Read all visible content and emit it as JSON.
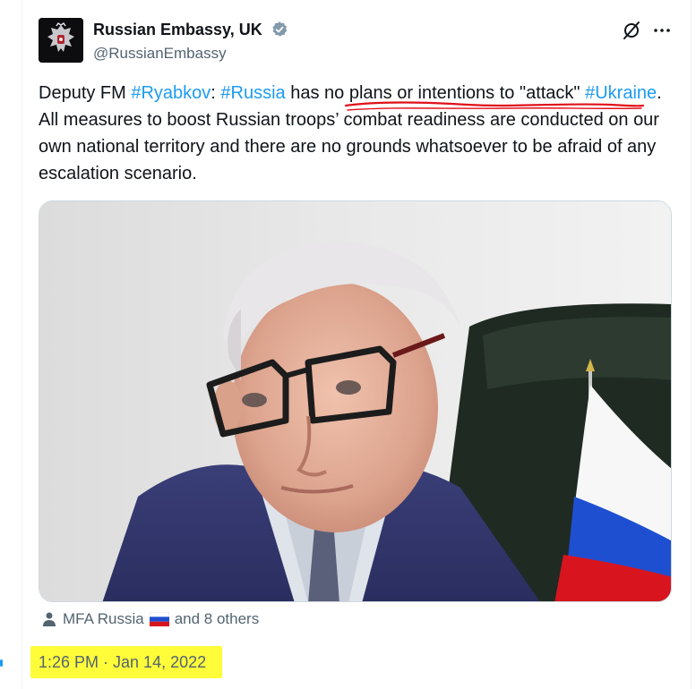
{
  "tweet": {
    "author": {
      "display_name": "Russian Embassy, UK",
      "handle": "@RussianEmbassy",
      "verified": true,
      "avatar_icon": "russian-coat-of-arms-icon"
    },
    "text": {
      "p1": "Deputy FM ",
      "hashtag1": "#Ryabkov",
      "p2": ": ",
      "hashtag2": "#Russia",
      "p3": " has ",
      "underlined": "no plans or intentions to \"attack\"",
      "p4": " ",
      "hashtag3": "#Ukraine",
      "p5": ". All measures to boost Russian troops’ combat readiness are conducted on our own national territory and there are no grounds whatsoever to be afraid of any escalation scenario."
    },
    "media": {
      "subject": "photo-of-man-with-glasses-and-russian-flag"
    },
    "tagged": {
      "first": "MFA Russia",
      "rest": "and 8 others"
    },
    "timestamp": "1:26 PM · Jan 14, 2022",
    "colors": {
      "accent": "#1d9bf0",
      "text": "#0f1419",
      "secondary": "#536471",
      "highlight": "#fffc3a",
      "annotation_red": "#e0101a"
    }
  }
}
